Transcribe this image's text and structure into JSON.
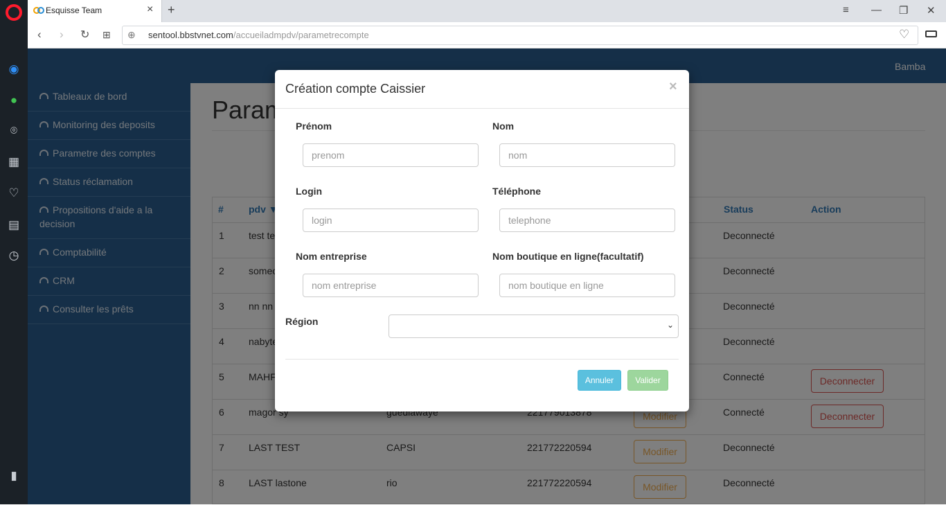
{
  "browser": {
    "tab_title": "Esquisse Team",
    "tab_close": "×",
    "new_tab": "+",
    "url_host": "sentool.bbstvnet.com",
    "url_path": "/accueiladmpdv/parametrecompte",
    "win_minimize": "—",
    "win_restore": "❐",
    "win_close": "✕"
  },
  "header": {
    "user": "Bamba"
  },
  "sidebar": {
    "items": [
      {
        "label": "Tableaux de bord"
      },
      {
        "label": "Monitoring des deposits"
      },
      {
        "label": "Parametre des comptes"
      },
      {
        "label": "Status réclamation"
      },
      {
        "label": "Propositions d'aide a la decision"
      },
      {
        "label": "Comptabilité"
      },
      {
        "label": "CRM"
      },
      {
        "label": "Consulter les prêts"
      }
    ]
  },
  "page": {
    "title": "Param"
  },
  "table": {
    "headers": {
      "num": "#",
      "pdv": "pdv ▼",
      "status": "Status",
      "action": "Action"
    },
    "rows": [
      {
        "num": "1",
        "pdv": "test te",
        "commune": "",
        "phone": "",
        "status": "Deconnecté",
        "modify": "",
        "disconnect": ""
      },
      {
        "num": "2",
        "pdv": "somec",
        "commune": "",
        "phone": "",
        "status": "Deconnecté",
        "modify": "",
        "disconnect": ""
      },
      {
        "num": "3",
        "pdv": "nn nn",
        "commune": "",
        "phone": "",
        "status": "Deconnecté",
        "modify": "",
        "disconnect": ""
      },
      {
        "num": "4",
        "pdv": "nabyte",
        "commune": "",
        "phone": "",
        "status": "Deconnecté",
        "modify": "",
        "disconnect": ""
      },
      {
        "num": "5",
        "pdv": "MAHF",
        "commune": "",
        "phone": "",
        "status": "Connecté",
        "modify": "",
        "disconnect": "Deconnecter"
      },
      {
        "num": "6",
        "pdv": "magor sy",
        "commune": "guediawaye",
        "phone": "221779013878",
        "status": "Connecté",
        "modify": "Modifier",
        "disconnect": "Deconnecter"
      },
      {
        "num": "7",
        "pdv": "LAST TEST",
        "commune": "CAPSI",
        "phone": "221772220594",
        "status": "Deconnecté",
        "modify": "Modifier",
        "disconnect": ""
      },
      {
        "num": "8",
        "pdv": "LAST lastone",
        "commune": "rio",
        "phone": "221772220594",
        "status": "Deconnecté",
        "modify": "Modifier",
        "disconnect": ""
      }
    ]
  },
  "modal": {
    "title": "Création compte Caissier",
    "close": "×",
    "fields": {
      "prenom": {
        "label": "Prénom",
        "placeholder": "prenom"
      },
      "nom": {
        "label": "Nom",
        "placeholder": "nom"
      },
      "login": {
        "label": "Login",
        "placeholder": "login"
      },
      "telephone": {
        "label": "Téléphone",
        "placeholder": "telephone"
      },
      "entreprise": {
        "label": "Nom entreprise",
        "placeholder": "nom entreprise"
      },
      "boutique": {
        "label": "Nom boutique en ligne(facultatif)",
        "placeholder": "nom boutique en ligne"
      },
      "region": {
        "label": "Région",
        "value": ""
      }
    },
    "cancel": "Annuler",
    "submit": "Valider"
  },
  "colors": {
    "sidebar": "#2a5f91",
    "link": "#337ab7",
    "info": "#5bc0de",
    "success": "#9dd69d",
    "warning": "#f0ad4e",
    "danger": "#d9534f"
  }
}
